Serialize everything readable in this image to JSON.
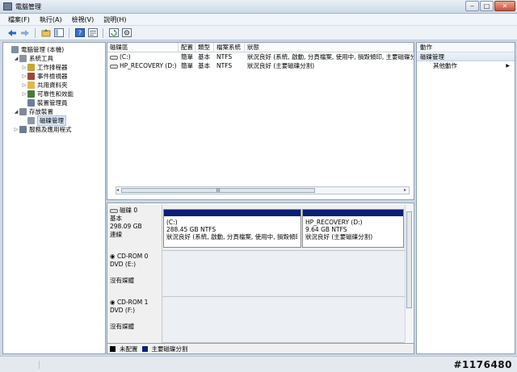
{
  "window": {
    "title": "電腦管理",
    "controls": {
      "minimize": "‒",
      "maximize": "□",
      "close": "✕"
    }
  },
  "menu": [
    "檔案(F)",
    "執行(A)",
    "檢視(V)",
    "說明(H)"
  ],
  "toolbar": {
    "icons": [
      "back-arrow-icon",
      "forward-arrow-icon",
      "up-folder-icon",
      "console-tree-icon",
      "help-icon",
      "properties-icon",
      "refresh-icon",
      "settings-icon"
    ]
  },
  "tree": [
    {
      "label": "電腦管理 (本機)",
      "indent": 0,
      "expander": "",
      "icon": "computer-icon",
      "color": "#7b8fa8"
    },
    {
      "label": "系統工具",
      "indent": 1,
      "expander": "◢",
      "icon": "tools-icon",
      "color": "#8a94a0"
    },
    {
      "label": "工作排程器",
      "indent": 2,
      "expander": "▷",
      "icon": "clock-icon",
      "color": "#c9a43a"
    },
    {
      "label": "事件檢視器",
      "indent": 2,
      "expander": "▷",
      "icon": "event-viewer-icon",
      "color": "#9a4a3a"
    },
    {
      "label": "共用資料夾",
      "indent": 2,
      "expander": "▷",
      "icon": "shared-folder-icon",
      "color": "#e0b84a"
    },
    {
      "label": "可靠性和效能",
      "indent": 2,
      "expander": "▷",
      "icon": "performance-icon",
      "color": "#4a7a3a"
    },
    {
      "label": "裝置管理員",
      "indent": 2,
      "expander": "",
      "icon": "device-manager-icon",
      "color": "#6b7f99"
    },
    {
      "label": "存放裝置",
      "indent": 1,
      "expander": "◢",
      "icon": "storage-icon",
      "color": "#7f8a96"
    },
    {
      "label": "磁碟管理",
      "indent": 2,
      "expander": "",
      "icon": "disk-management-icon",
      "color": "#8d99a8",
      "selected": true
    },
    {
      "label": "服務及應用程式",
      "indent": 1,
      "expander": "▷",
      "icon": "services-icon",
      "color": "#6f7d90"
    }
  ],
  "volumes": {
    "columns": [
      "磁碟區",
      "配置",
      "類型",
      "檔案系統",
      "狀態"
    ],
    "rows": [
      [
        "(C:)",
        "簡單",
        "基本",
        "NTFS",
        "狀況良好 (系統, 啟動, 分頁檔案, 使用中, 損毀傾印, 主要磁碟分"
      ],
      [
        "HP_RECOVERY (D:)",
        "簡單",
        "基本",
        "NTFS",
        "狀況良好 (主要磁碟分割)"
      ]
    ]
  },
  "disks": [
    {
      "name": "磁碟 0",
      "lines": [
        "基本",
        "298.09 GB",
        "連線"
      ],
      "partitions": [
        {
          "title": "(C:)",
          "size": "288.45 GB NTFS",
          "status": "狀況良好 (系統, 啟動, 分頁檔案, 使用中, 損毀傾印"
        },
        {
          "title": "HP_RECOVERY (D:)",
          "size": "9.64 GB NTFS",
          "status": "狀況良好 (主要磁碟分割)"
        }
      ]
    },
    {
      "name": "CD-ROM 0",
      "lines": [
        "DVD (E:)",
        "",
        "沒有媒體"
      ],
      "partitions": []
    },
    {
      "name": "CD-ROM 1",
      "lines": [
        "DVD (F:)",
        "",
        "沒有媒體"
      ],
      "partitions": []
    }
  ],
  "legend": [
    {
      "label": "未配置",
      "color": "#000000"
    },
    {
      "label": "主要磁碟分割",
      "color": "#0a1f7a"
    }
  ],
  "actions": {
    "title": "動作",
    "section": "磁碟管理",
    "items": [
      {
        "label": "其他動作"
      }
    ]
  },
  "watermark": "#1176480"
}
